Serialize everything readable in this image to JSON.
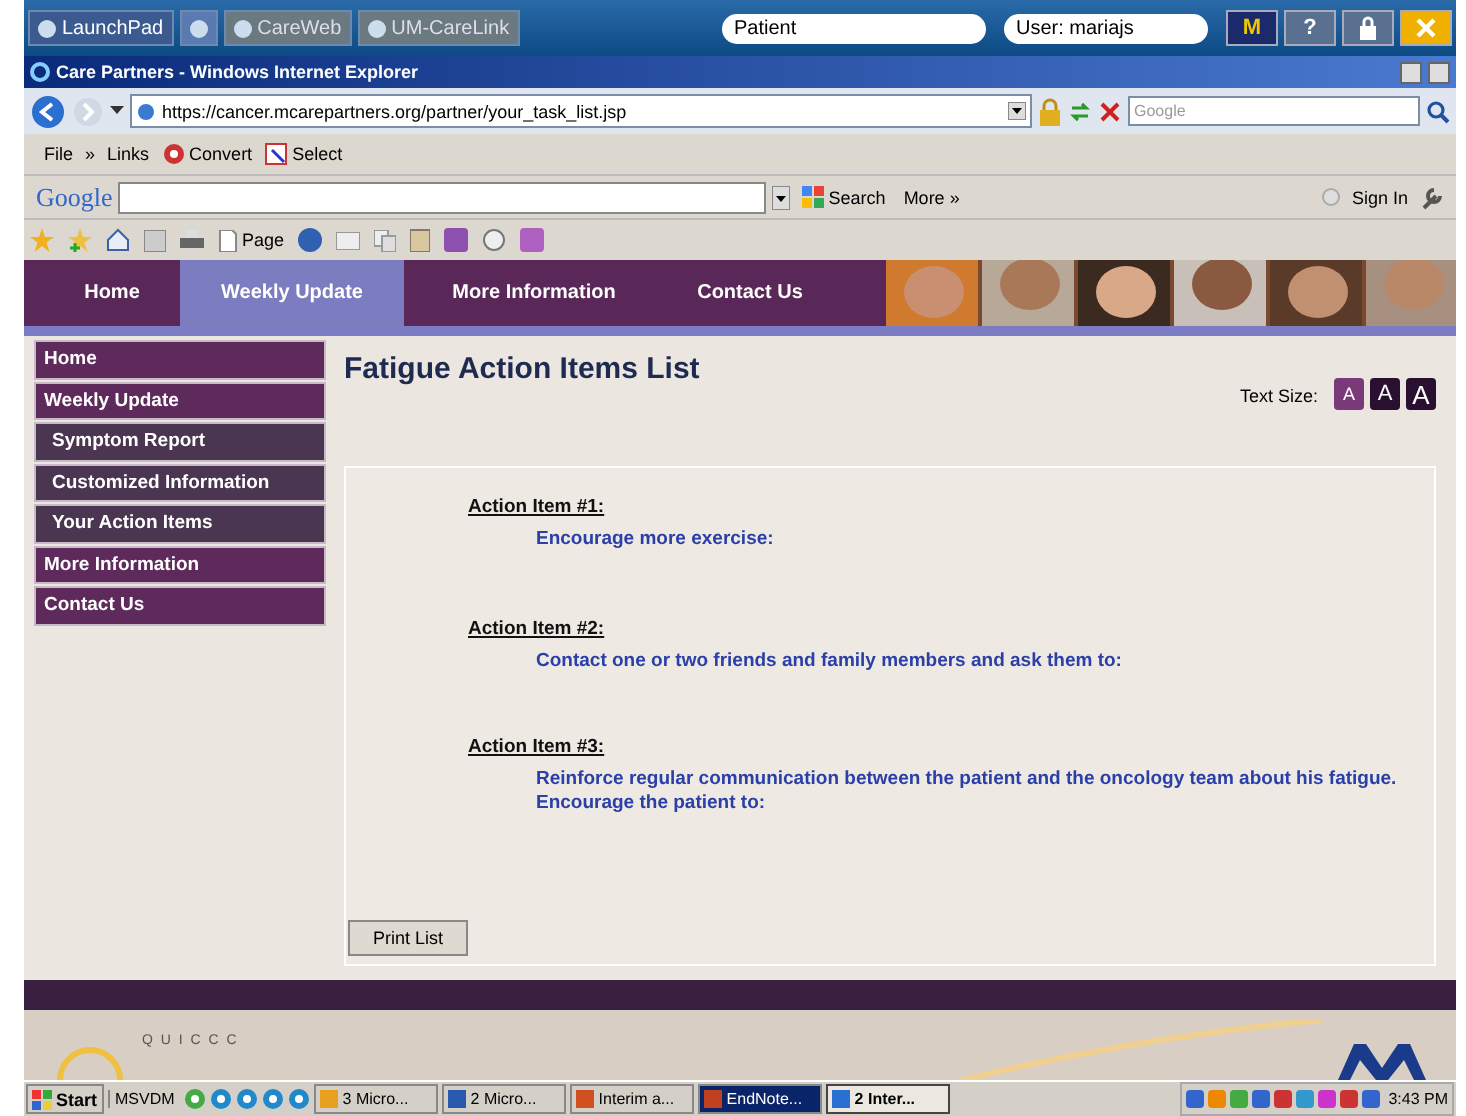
{
  "launchbar": {
    "buttons": [
      {
        "label": "LaunchPad",
        "kind": "launch"
      },
      {
        "kind": "ie"
      },
      {
        "label": "CareWeb",
        "kind": "dim"
      },
      {
        "label": "UM-CareLink",
        "kind": "dim"
      }
    ],
    "patient_field": {
      "value": "Patient"
    },
    "user_field": {
      "value": "User: mariajs"
    },
    "m_button": "M",
    "help_button": "?"
  },
  "window": {
    "title": "Care Partners - Windows Internet Explorer"
  },
  "address_bar": {
    "url": "https://cancer.mcarepartners.org/partner/your_task_list.jsp",
    "search_placeholder": "Google"
  },
  "menu_bar": {
    "items": [
      "File",
      "»",
      "Links",
      "Convert",
      "Select"
    ]
  },
  "google_toolbar": {
    "logo": "Google",
    "search": "Search",
    "more": "More »",
    "sign_in": "Sign In"
  },
  "command_bar": {
    "page": "Page"
  },
  "site_nav": {
    "tabs": [
      {
        "label": "Home",
        "selected": false
      },
      {
        "label": "Weekly Update",
        "selected": true
      },
      {
        "label": "More Information",
        "selected": false
      },
      {
        "label": "Contact Us",
        "selected": false
      }
    ]
  },
  "sidebar": {
    "items": [
      {
        "label": "Home",
        "kind": "top"
      },
      {
        "label": "Weekly Update",
        "kind": "top"
      },
      {
        "label": "Symptom Report",
        "kind": "sub"
      },
      {
        "label": "Customized Information",
        "kind": "sub"
      },
      {
        "label": "Your Action Items",
        "kind": "sub"
      },
      {
        "label": "More Information",
        "kind": "top"
      },
      {
        "label": "Contact Us",
        "kind": "top"
      }
    ]
  },
  "main": {
    "heading": "Fatigue Action Items List",
    "text_size_label": "Text Size:",
    "text_sizes": [
      {
        "label": "A",
        "selected": true
      },
      {
        "label": "A",
        "selected": false
      },
      {
        "label": "A",
        "selected": false
      }
    ],
    "action_items": [
      {
        "title": "Action Item #1:",
        "text": "Encourage more exercise:"
      },
      {
        "title": "Action Item #2:",
        "text": "Contact one or two friends and family members and ask them to:"
      },
      {
        "title": "Action Item #3:",
        "text": "Reinforce regular communication between the patient and the oncology team about his fatigue. Encourage the patient to:"
      }
    ],
    "print_button": "Print List"
  },
  "footer": {
    "logo_text": "Q U I C C C"
  },
  "taskbar": {
    "start": "Start",
    "toolbar_label": "MSVDM",
    "tasks": [
      {
        "label": "3 Micro...",
        "selected": false,
        "flashing": false
      },
      {
        "label": "2 Micro...",
        "selected": false,
        "flashing": false
      },
      {
        "label": "Interim a...",
        "selected": false,
        "flashing": false
      },
      {
        "label": "EndNote...",
        "selected": false,
        "flashing": true
      },
      {
        "label": "2 Inter...",
        "selected": true,
        "flashing": false
      }
    ],
    "clock": "3:43 PM"
  }
}
